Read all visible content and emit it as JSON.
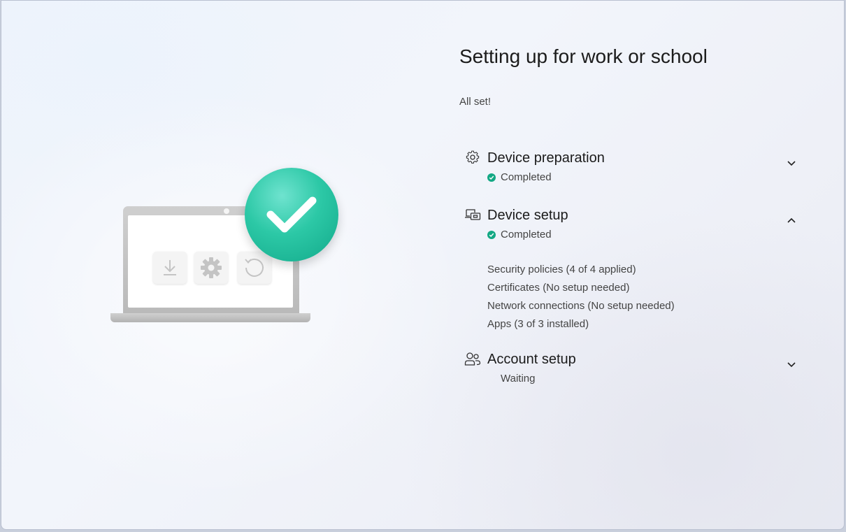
{
  "page": {
    "title": "Setting up for work or school",
    "subtitle": "All set!"
  },
  "sections": [
    {
      "title": "Device preparation",
      "icon": "gear-icon",
      "status": "Completed",
      "status_color": "#13a884",
      "expanded": false
    },
    {
      "title": "Device setup",
      "icon": "device-setup-icon",
      "status": "Completed",
      "status_color": "#13a884",
      "expanded": true,
      "details": [
        "Security policies (4 of 4 applied)",
        "Certificates (No setup needed)",
        "Network connections (No setup needed)",
        "Apps (3 of 3 installed)"
      ]
    },
    {
      "title": "Account setup",
      "icon": "people-icon",
      "status": "Waiting",
      "expanded": false
    }
  ],
  "illustration": {
    "laptop_icons": [
      "download-icon",
      "gear-icon",
      "refresh-icon"
    ],
    "badge": "check-icon",
    "badge_color": "#2cc8a6"
  }
}
